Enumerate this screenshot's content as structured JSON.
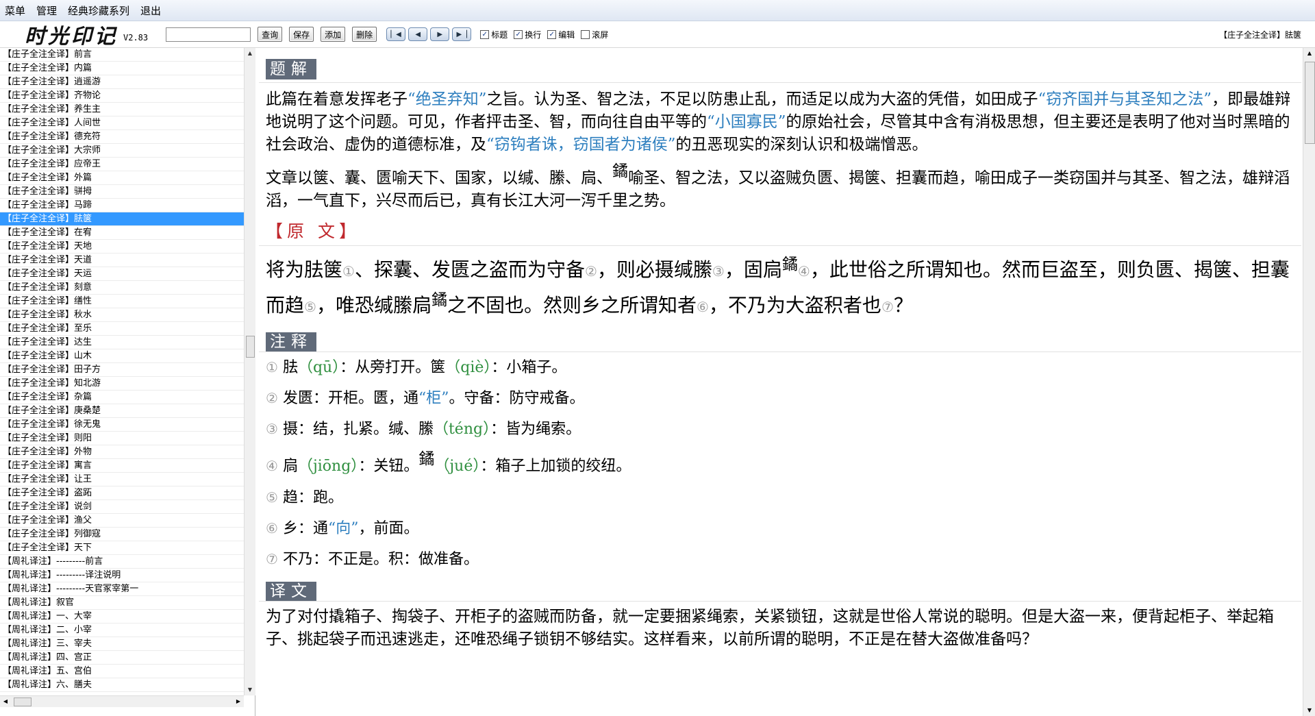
{
  "menu": [
    "菜单",
    "管理",
    "经典珍藏系列",
    "退出"
  ],
  "toolbar": {
    "logo": "时光印记",
    "version": "V2.83",
    "search_value": "",
    "query_label": "查询",
    "save_label": "保存",
    "add_label": "添加",
    "delete_label": "删除",
    "chk_title": "标题",
    "chk_wrap": "换行",
    "chk_edit": "编辑",
    "chk_scroll": "滚屏",
    "current_title": "【庄子全注全译】胠箧"
  },
  "sidebar": {
    "items": [
      "【庄子全注全译】前言",
      "【庄子全注全译】内篇",
      "【庄子全注全译】逍遥游",
      "【庄子全注全译】齐物论",
      "【庄子全注全译】养生主",
      "【庄子全注全译】人间世",
      "【庄子全注全译】德充符",
      "【庄子全注全译】大宗师",
      "【庄子全注全译】应帝王",
      "【庄子全注全译】外篇",
      "【庄子全注全译】骈拇",
      "【庄子全注全译】马蹄",
      "【庄子全注全译】胠箧",
      "【庄子全注全译】在宥",
      "【庄子全注全译】天地",
      "【庄子全注全译】天道",
      "【庄子全注全译】天运",
      "【庄子全注全译】刻意",
      "【庄子全注全译】缮性",
      "【庄子全注全译】秋水",
      "【庄子全注全译】至乐",
      "【庄子全注全译】达生",
      "【庄子全注全译】山木",
      "【庄子全注全译】田子方",
      "【庄子全注全译】知北游",
      "【庄子全注全译】杂篇",
      "【庄子全注全译】庚桑楚",
      "【庄子全注全译】徐无鬼",
      "【庄子全注全译】则阳",
      "【庄子全注全译】外物",
      "【庄子全注全译】寓言",
      "【庄子全注全译】让王",
      "【庄子全注全译】盗跖",
      "【庄子全注全译】说剑",
      "【庄子全注全译】渔父",
      "【庄子全注全译】列御寇",
      "【庄子全注全译】天下",
      "【周礼译注】---------前言",
      "【周礼译注】---------译注说明",
      "【周礼译注】---------天官冢宰第一",
      "【周礼译注】叙官",
      "【周礼译注】一、大宰",
      "【周礼译注】二、小宰",
      "【周礼译注】三、宰夫",
      "【周礼译注】四、宫正",
      "【周礼译注】五、宫伯",
      "【周礼译注】六、膳夫"
    ],
    "selected_index": 12
  },
  "content": {
    "h_jieti": "题解",
    "p1": {
      "a": "此篇在着意发挥老子",
      "b": "“绝圣弃知”",
      "c": "之旨。认为圣、智之法，不足以防患止乱，而适足以成为大盗的凭借，如田成子",
      "d": "“窃齐国并与其圣知之法”",
      "e": "，即最雄辩地说明了这个问题。可见，作者抨击圣、智，而向往自由平等的",
      "f": "“小国寡民”",
      "g": "的原始社会，尽管其中含有消极思想，但主要还是表明了他对当时黑暗的社会政治、虚伪的道德标准，及",
      "h": "“窃钩者诛，窃国者为诸侯”",
      "i": "的丑恶现实的深刻认识和极端憎恶。"
    },
    "p2": {
      "a": "文章以箧、囊、匮喻天下、国家，以缄、縢、扃、",
      "rare": "鐍",
      "b": "喻圣、智之法，又以盗贼负匮、揭箧、担囊而趋，喻田成子一类窃国并与其圣、智之法，雄辩滔滔，一气直下，兴尽而后已，真有长江大河一泻千里之势。"
    },
    "h_yuanwen": "【原 文】",
    "orig": {
      "a": "将为胠箧",
      "n1": "①",
      "b": "、探囊、发匮之盗而为守备",
      "n2": "②",
      "c": "，则必摄缄縢",
      "n3": "③",
      "d": "，固扃",
      "rare": "鐍",
      "n4": "④",
      "e": "，此世俗之所谓知也。然而巨盗至，则负匮、揭箧、担囊而趋",
      "n5": "⑤",
      "f": "，唯恐缄縢扃",
      "rare2": "鐍",
      "g": "之不固也。然则乡之所谓知者",
      "n6": "⑥",
      "h": "，不乃为大盗积者也",
      "n7": "⑦",
      "i": "？"
    },
    "h_zhushi": "注释",
    "notes": {
      "n1": {
        "num": "①",
        "a": "胠",
        "b": "（qū）",
        "c": "：从旁打开。箧",
        "d": "（qiè）",
        "e": "：小箱子。"
      },
      "n2": {
        "num": "②",
        "a": "发匮：开柜。匮，通",
        "b": "“柜”",
        "c": "。守备：防守戒备。"
      },
      "n3": {
        "num": "③",
        "a": "摄：结，扎紧。缄、縢",
        "b": "（téng）",
        "c": "：皆为绳索。"
      },
      "n4": {
        "num": "④",
        "a": "扃",
        "b": "（jiōng）",
        "c": "：关钮。",
        "rare": "鐍",
        "d": "（jué）",
        "e": "：箱子上加锁的绞纽。"
      },
      "n5": {
        "num": "⑤",
        "a": "趋：跑。"
      },
      "n6": {
        "num": "⑥",
        "a": "乡：通",
        "b": "“向”",
        "c": "，前面。"
      },
      "n7": {
        "num": "⑦",
        "a": "不乃：不正是。积：做准备。"
      }
    },
    "h_yiwen": "译文",
    "p3": "为了对付撬箱子、掏袋子、开柜子的盗贼而防备，就一定要捆紧绳索，关紧锁钮，这就是世俗人常说的聪明。但是大盗一来，便背起柜子、举起箱子、挑起袋子而迅速逃走，还唯恐绳子锁钥不够结实。这样看来，以前所谓的聪明，不正是在替大盗做准备吗？"
  },
  "colors": {
    "highlight": "#2e7fbf",
    "pinyin": "#2f8f3f",
    "heading_bg": "#606a79",
    "selection": "#3399ff",
    "red": "#c0282d"
  }
}
